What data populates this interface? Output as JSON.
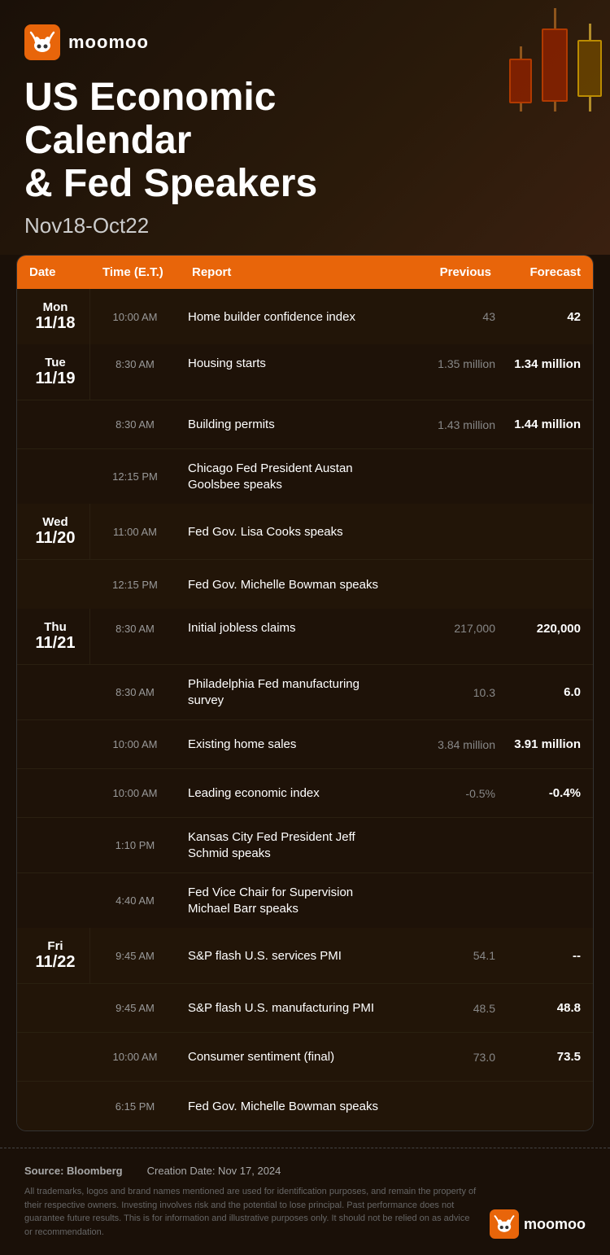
{
  "brand": {
    "name": "moomoo"
  },
  "header": {
    "title_line1": "US Economic Calendar",
    "title_line2": "& Fed Speakers",
    "date_range": "Nov18-Oct22"
  },
  "table": {
    "columns": [
      "Date",
      "Time (E.T.)",
      "Report",
      "Previous",
      "Forecast"
    ],
    "days": [
      {
        "id": "mon",
        "day_name": "Mon",
        "day_num": "11/18",
        "rows": [
          {
            "time": "10:00 AM",
            "report": "Home builder confidence index",
            "previous": "43",
            "forecast": "42"
          }
        ]
      },
      {
        "id": "tue",
        "day_name": "Tue",
        "day_num": "11/19",
        "rows": [
          {
            "time": "8:30 AM",
            "report": "Housing starts",
            "previous": "1.35 million",
            "forecast": "1.34 million"
          },
          {
            "time": "8:30 AM",
            "report": "Building permits",
            "previous": "1.43 million",
            "forecast": "1.44 million"
          },
          {
            "time": "12:15 PM",
            "report": "Chicago Fed President Austan Goolsbee speaks",
            "previous": "",
            "forecast": ""
          }
        ]
      },
      {
        "id": "wed",
        "day_name": "Wed",
        "day_num": "11/20",
        "rows": [
          {
            "time": "11:00 AM",
            "report": "Fed Gov. Lisa Cooks speaks",
            "previous": "",
            "forecast": ""
          },
          {
            "time": "12:15 PM",
            "report": "Fed Gov. Michelle Bowman speaks",
            "previous": "",
            "forecast": ""
          }
        ]
      },
      {
        "id": "thu",
        "day_name": "Thu",
        "day_num": "11/21",
        "rows": [
          {
            "time": "8:30 AM",
            "report": "Initial jobless claims",
            "previous": "217,000",
            "forecast": "220,000"
          },
          {
            "time": "8:30 AM",
            "report": "Philadelphia Fed manufacturing survey",
            "previous": "10.3",
            "forecast": "6.0"
          },
          {
            "time": "10:00 AM",
            "report": "Existing home sales",
            "previous": "3.84 million",
            "forecast": "3.91 million"
          },
          {
            "time": "10:00 AM",
            "report": "Leading economic index",
            "previous": "-0.5%",
            "forecast": "-0.4%"
          },
          {
            "time": "1:10 PM",
            "report": "Kansas City Fed President Jeff Schmid speaks",
            "previous": "",
            "forecast": ""
          },
          {
            "time": "4:40 AM",
            "report": "Fed Vice Chair for Supervision Michael Barr speaks",
            "previous": "",
            "forecast": ""
          }
        ]
      },
      {
        "id": "fri",
        "day_name": "Fri",
        "day_num": "11/22",
        "rows": [
          {
            "time": "9:45 AM",
            "report": "S&P flash U.S. services PMI",
            "previous": "54.1",
            "forecast": "--"
          },
          {
            "time": "9:45 AM",
            "report": "S&P flash U.S. manufacturing PMI",
            "previous": "48.5",
            "forecast": "48.8"
          },
          {
            "time": "10:00 AM",
            "report": "Consumer sentiment (final)",
            "previous": "73.0",
            "forecast": "73.5"
          },
          {
            "time": "6:15 PM",
            "report": "Fed Gov. Michelle Bowman speaks",
            "previous": "",
            "forecast": ""
          }
        ]
      }
    ]
  },
  "footer": {
    "source_label": "Source: Bloomberg",
    "creation_label": "Creation Date: Nov 17, 2024",
    "disclaimer": "All trademarks, logos and brand names mentioned are used for identification purposes, and remain the property of their respective owners. Investing involves risk and the potential to lose principal. Past performance does not guarantee future results. This is for information and illustrative purposes only. It should not be relied on as advice or recommendation."
  }
}
